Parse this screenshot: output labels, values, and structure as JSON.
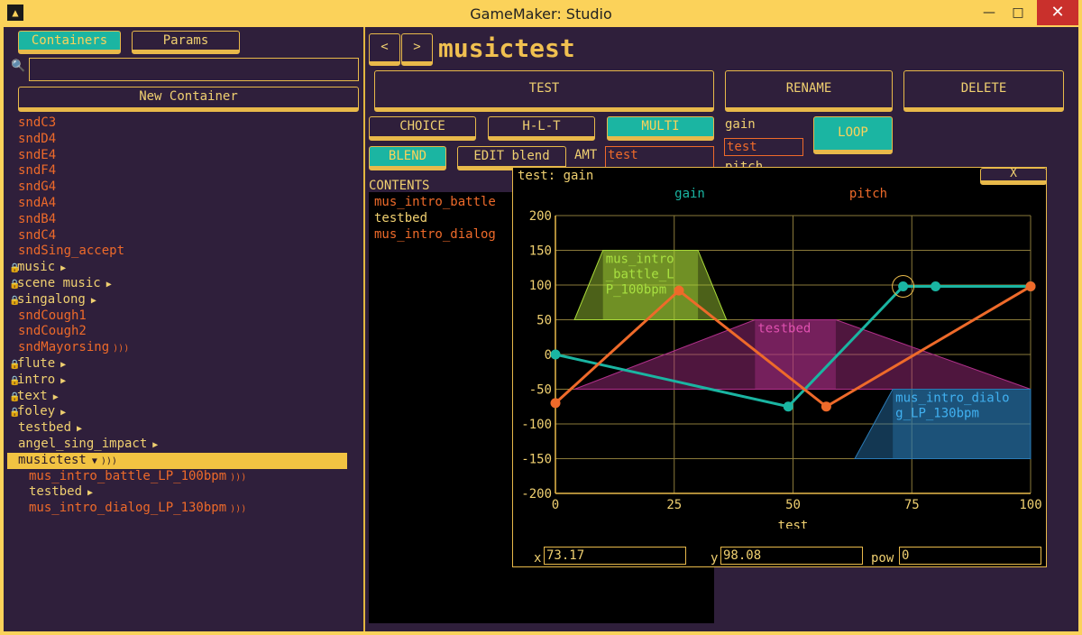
{
  "window": {
    "title": "GameMaker: Studio",
    "minimize": "—",
    "maximize": "□",
    "close": "✕"
  },
  "left": {
    "tabs": {
      "containers": "Containers",
      "params": "Params"
    },
    "search_value": "",
    "new_container": "New Container",
    "items": [
      {
        "label": "sndC3",
        "color": "orange"
      },
      {
        "label": "sndD4",
        "color": "orange"
      },
      {
        "label": "sndE4",
        "color": "orange"
      },
      {
        "label": "sndF4",
        "color": "orange"
      },
      {
        "label": "sndG4",
        "color": "orange"
      },
      {
        "label": "sndA4",
        "color": "orange"
      },
      {
        "label": "sndB4",
        "color": "orange"
      },
      {
        "label": "sndC4",
        "color": "orange"
      },
      {
        "label": "sndSing_accept",
        "color": "orange"
      },
      {
        "label": "music",
        "color": "yellow",
        "lock": true,
        "arrow": true
      },
      {
        "label": "scene music",
        "color": "yellow",
        "lock": true,
        "arrow": true
      },
      {
        "label": "singalong",
        "color": "yellow",
        "lock": true,
        "arrow": true
      },
      {
        "label": "sndCough1",
        "color": "orange"
      },
      {
        "label": "sndCough2",
        "color": "orange"
      },
      {
        "label": "sndMayorsing",
        "color": "orange",
        "sound": true
      },
      {
        "label": "flute",
        "color": "yellow",
        "lock": true,
        "arrow": true
      },
      {
        "label": "intro",
        "color": "yellow",
        "lock": true,
        "arrow": true
      },
      {
        "label": "text",
        "color": "yellow",
        "lock": true,
        "arrow": true
      },
      {
        "label": "foley",
        "color": "yellow",
        "lock": true,
        "arrow": true
      },
      {
        "label": "testbed",
        "color": "yellow",
        "arrow": true
      },
      {
        "label": "angel_sing_impact",
        "color": "yellow",
        "arrow": true
      },
      {
        "label": "musictest",
        "color": "selected",
        "down": true,
        "sound": true
      },
      {
        "label": "mus_intro_battle_LP_100bpm",
        "color": "orange",
        "indent": true,
        "sound": true
      },
      {
        "label": "testbed",
        "color": "yellow",
        "indent": true,
        "arrow": true
      },
      {
        "label": "mus_intro_dialog_LP_130bpm",
        "color": "orange",
        "indent": true,
        "sound": true
      }
    ]
  },
  "editor": {
    "nav_prev": "<",
    "nav_next": ">",
    "container_name": "musictest",
    "test": "TEST",
    "rename": "RENAME",
    "delete": "DELETE",
    "choice": "CHOICE",
    "hlt": "H-L-T",
    "multi": "MULTI",
    "blend": "BLEND",
    "edit_blend": "EDIT blend",
    "amt_label": "AMT",
    "amt_value": "test",
    "gain_label": "gain",
    "gain_value": "test",
    "pitch_label": "pitch",
    "loop": "LOOP",
    "contents_label": "CONTENTS",
    "contents": [
      {
        "label": "mus_intro_battle",
        "color": "#ee6a2a"
      },
      {
        "label": "testbed",
        "color": "#f0d070"
      },
      {
        "label": "mus_intro_dialog",
        "color": "#ee6a2a"
      }
    ]
  },
  "graph_window": {
    "title": "test: gain",
    "close": "X",
    "x_label": "x",
    "x_value": "73.17",
    "y_label": "y",
    "y_value": "98.08",
    "pow_label": "pow",
    "pow_value": "0"
  },
  "chart_data": {
    "type": "line",
    "xlabel": "test",
    "xlim": [
      0,
      100
    ],
    "ylim": [
      -200,
      200
    ],
    "x_ticks": [
      0,
      25,
      50,
      75,
      100
    ],
    "y_ticks": [
      200,
      150,
      100,
      50,
      0,
      -50,
      -100,
      -150,
      -200
    ],
    "grid": true,
    "legend": [
      "gain",
      "pitch"
    ],
    "colors": {
      "gain": "#1ab5a2",
      "pitch": "#ee6a2a",
      "grid": "#8a7a3a",
      "axis": "#e8b94a"
    },
    "series": [
      {
        "name": "gain",
        "points": [
          [
            0,
            0
          ],
          [
            49,
            -75
          ],
          [
            73.17,
            98.08
          ],
          [
            80,
            98
          ],
          [
            100,
            98
          ]
        ]
      },
      {
        "name": "pitch",
        "points": [
          [
            0,
            -70
          ],
          [
            26,
            92
          ],
          [
            57,
            -75
          ],
          [
            100,
            98
          ]
        ]
      }
    ],
    "selected_point": [
      73.17,
      98.08
    ],
    "regions": [
      {
        "label": "mus_intro\n_battle_L\nP_100bpm",
        "color": "#a8d838",
        "text_color": "#a8e040",
        "points": [
          [
            4,
            50
          ],
          [
            10,
            150
          ],
          [
            30,
            150
          ],
          [
            36,
            50
          ]
        ],
        "core": [
          10,
          30,
          50,
          150
        ]
      },
      {
        "label": "testbed",
        "color": "#b0308a",
        "text_color": "#e050b0",
        "points": [
          [
            4,
            -50
          ],
          [
            42,
            50
          ],
          [
            59,
            50
          ],
          [
            100,
            -50
          ]
        ],
        "core": [
          42,
          59,
          -50,
          50
        ]
      },
      {
        "label": "mus_intro_dialo\ng_LP_130bpm",
        "color": "#2a7ab5",
        "text_color": "#40b0f0",
        "points": [
          [
            63,
            -150
          ],
          [
            71,
            -50
          ],
          [
            100,
            -50
          ],
          [
            100,
            -150
          ]
        ],
        "core": [
          71,
          100,
          -150,
          -50
        ]
      }
    ]
  }
}
